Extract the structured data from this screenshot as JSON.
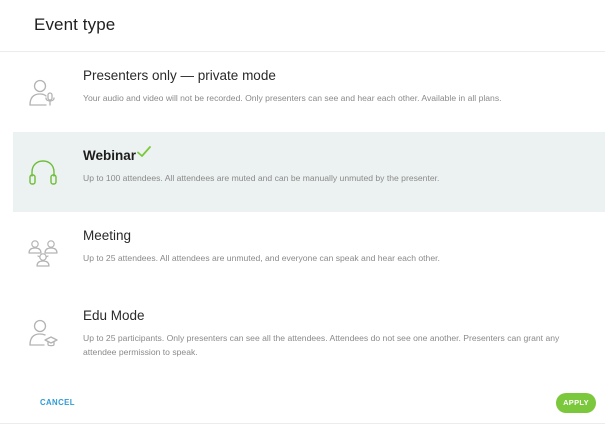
{
  "header": {
    "title": "Event type"
  },
  "options": [
    {
      "label": "Presenters only — private mode",
      "description": "Your audio and video will not be recorded. Only presenters can see and hear each other. Available in all plans.",
      "icon": "presenter-mic-icon",
      "selected": false
    },
    {
      "label": "Webinar",
      "description": "Up to 100 attendees. All attendees are muted and can be manually unmuted by the presenter.",
      "icon": "headphones-icon",
      "selected": true
    },
    {
      "label": "Meeting",
      "description": "Up to 25 attendees. All attendees are unmuted, and everyone can speak and hear each other.",
      "icon": "group-people-icon",
      "selected": false
    },
    {
      "label": "Edu Mode",
      "description": "Up to 25 participants. Only presenters can see all the attendees. Attendees do not see one another. Presenters can grant any attendee permission to speak.",
      "icon": "graduate-person-icon",
      "selected": false
    }
  ],
  "footer": {
    "cancel_label": "CANCEL",
    "apply_label": "APPLY"
  },
  "colors": {
    "accent_green": "#7cc83c",
    "cancel_blue": "#2f9bd6",
    "selected_bg": "#ecf2f1",
    "icon_gray": "#b3b3b3",
    "icon_green": "#6ebd3a"
  }
}
